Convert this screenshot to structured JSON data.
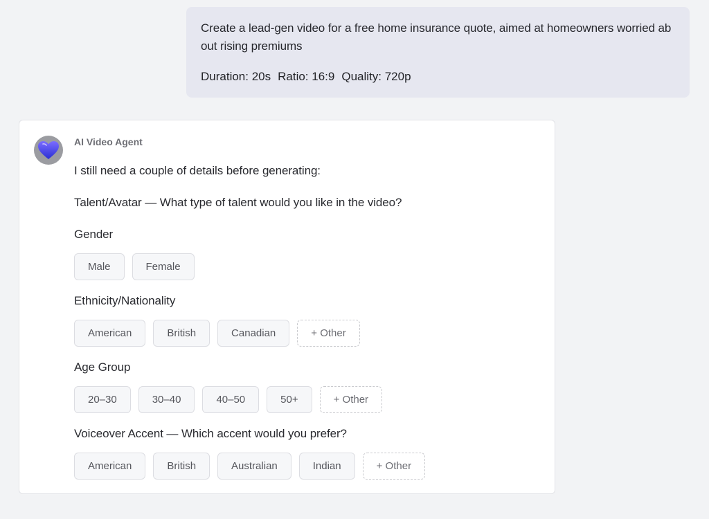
{
  "user_message": {
    "prompt": "Create a lead-gen video for a free home insurance quote, aimed at homeowners worried about rising premiums",
    "settings": {
      "duration": "Duration: 20s",
      "ratio": "Ratio: 16:9",
      "quality": "Quality: 720p"
    }
  },
  "agent_message": {
    "name": "AI Video Agent",
    "avatar_icon": "heart-icon",
    "intro": "I still need a couple of details before generating:",
    "talent_question": "Talent/Avatar — What type of talent would you like in the video?",
    "gender": {
      "label": "Gender",
      "options": [
        "Male",
        "Female"
      ]
    },
    "ethnicity": {
      "label": "Ethnicity/Nationality",
      "options": [
        "American",
        "British",
        "Canadian",
        "+ Other"
      ]
    },
    "age_group": {
      "label": "Age Group",
      "options": [
        "20–30",
        "30–40",
        "40–50",
        "50+",
        "+ Other"
      ]
    },
    "voiceover_question": "Voiceover Accent — Which accent would you prefer?",
    "accent": {
      "options": [
        "American",
        "British",
        "Australian",
        "Indian",
        "+ Other"
      ]
    }
  },
  "colors": {
    "background": "#f2f3f5",
    "user_bubble": "#e6e7f0",
    "card": "#ffffff",
    "avatar_bg": "#9b9ca1",
    "heart_top": "#6a5cf0",
    "heart_bottom": "#2b2fd6"
  }
}
